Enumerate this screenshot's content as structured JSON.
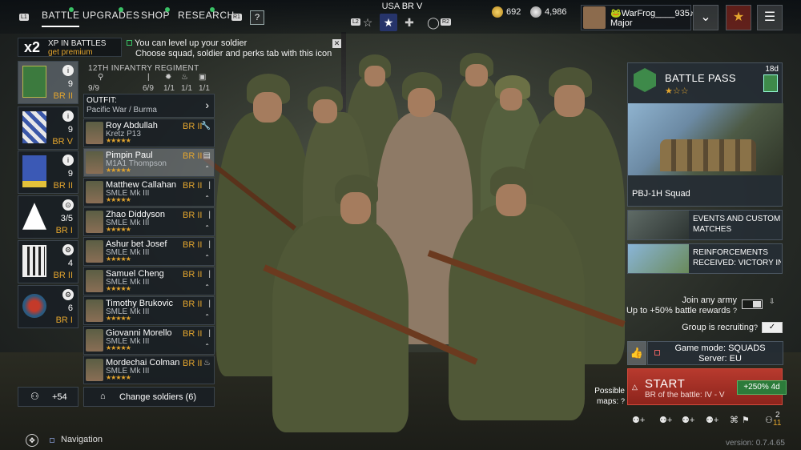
{
  "topbar": {
    "tabs": [
      {
        "label": "BATTLE",
        "key": "L1"
      },
      {
        "label": "UPGRADES"
      },
      {
        "label": "SHOP"
      },
      {
        "label": "RESEARCH",
        "key": "R1"
      }
    ],
    "help": "?",
    "nation": {
      "country": "USA",
      "br": "BR V"
    },
    "mode_keys": {
      "left": "L2",
      "right": "R2"
    },
    "currency": {
      "gold": "692",
      "silver": "4,986"
    },
    "profile": {
      "name": "🐸WarFrog____935♪",
      "rank": "Major"
    }
  },
  "xp_banner": {
    "multiplier": "x2",
    "line1": "XP IN BATTLES",
    "line2": "get premium"
  },
  "hint": {
    "line1": "You can level up your soldier",
    "line2": "Choose squad, soldier and perks tab with this icon"
  },
  "squads": [
    {
      "count": "9",
      "br": "BR II",
      "info": "i"
    },
    {
      "count": "9",
      "br": "BR V",
      "info": "i"
    },
    {
      "count": "9",
      "br": "BR II",
      "info": "i"
    },
    {
      "count": "3/5",
      "br": "BR I",
      "info": "⊙"
    },
    {
      "count": "4",
      "br": "BR II",
      "info": "⚙"
    },
    {
      "count": "6",
      "br": "BR I",
      "info": "⚙"
    }
  ],
  "regiment": {
    "name": "12TH INFANTRY REGIMENT",
    "stats": [
      "9/9",
      "6/9",
      "1/1",
      "1/1",
      "1/1"
    ]
  },
  "outfit": {
    "label": "OUTFIT:",
    "value": "Pacific War / Burma"
  },
  "soldiers": [
    {
      "name": "Roy Abdullah",
      "weapon": "Kretz P13",
      "br": "BR II",
      "stars": "★★★★★",
      "icon": "🔧"
    },
    {
      "name": "Pimpin Paul",
      "weapon": "M1A1 Thompson",
      "br": "BR II",
      "stars": "★★★★★",
      "icon": "▤"
    },
    {
      "name": "Matthew Callahan",
      "weapon": "SMLE Mk III",
      "br": "BR II",
      "stars": "★★★★★",
      "icon": "|"
    },
    {
      "name": "Zhao Diddyson",
      "weapon": "SMLE Mk III",
      "br": "BR II",
      "stars": "★★★★★",
      "icon": "|"
    },
    {
      "name": "Ashur bet Josef",
      "weapon": "SMLE Mk III",
      "br": "BR II",
      "stars": "★★★★★",
      "icon": "|"
    },
    {
      "name": "Samuel Cheng",
      "weapon": "SMLE Mk III",
      "br": "BR II",
      "stars": "★★★★★",
      "icon": "|"
    },
    {
      "name": "Timothy Brukovic",
      "weapon": "SMLE Mk III",
      "br": "BR II",
      "stars": "★★★★★",
      "icon": "|"
    },
    {
      "name": "Giovanni Morello",
      "weapon": "SMLE Mk III",
      "br": "BR II",
      "stars": "★★★★★",
      "icon": "|"
    },
    {
      "name": "Mordechai Colman",
      "weapon": "SMLE Mk III",
      "br": "BR II",
      "stars": "★★★★★",
      "icon": "♨"
    }
  ],
  "bottom_left": {
    "reserve_count": "+54",
    "change_soldiers": "Change soldiers (6)",
    "navigation": "Navigation"
  },
  "battle_pass": {
    "title": "BATTLE PASS",
    "stars_filled": 1,
    "stars_total": 3,
    "days": "18d",
    "reward": "PBJ-1H Squad"
  },
  "events": [
    {
      "line1": "EVENTS AND CUSTOM",
      "line2": "MATCHES"
    },
    {
      "line1": "REINFORCEMENTS",
      "line2": "RECEIVED: VICTORY IN"
    }
  ],
  "join_army": {
    "line1": "Join any army",
    "line2": "Up to +50% battle rewards"
  },
  "group_recruiting": "Group is recruiting",
  "game_mode": {
    "line1": "Game mode: SQUADS",
    "line2": "Server: EU"
  },
  "possible_maps": {
    "line1": "Possible",
    "line2": "maps:"
  },
  "start": {
    "label": "START",
    "sub": "BR of the battle: IV - V",
    "boost": "+250% 4d"
  },
  "party": {
    "count": "2",
    "sub": "11"
  },
  "version": "version: 0.7.4.65",
  "colors": {
    "accent_gold": "#e3a52e",
    "start_red": "#b83a2e",
    "green": "#3ac266"
  }
}
